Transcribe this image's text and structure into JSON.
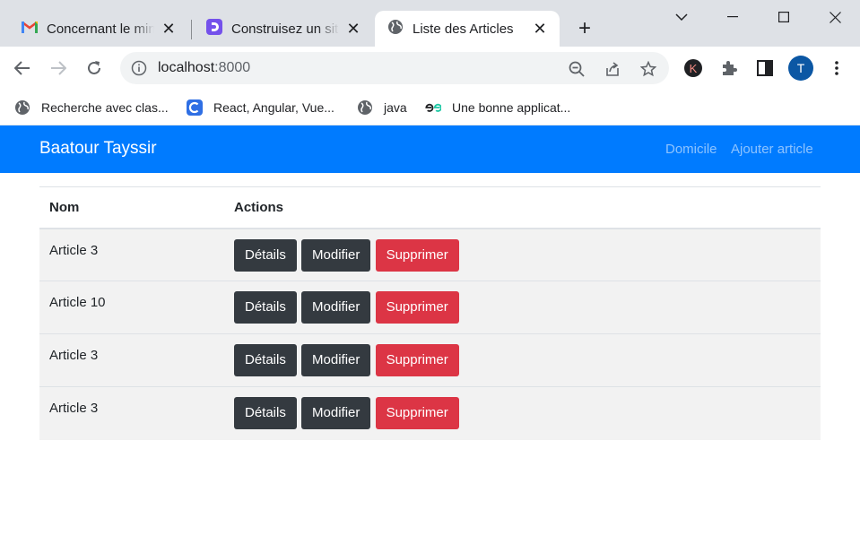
{
  "browser": {
    "tabs": [
      {
        "title": "Concernant le mini",
        "icon": "gmail-icon"
      },
      {
        "title": "Construisez un site",
        "icon": "openclassrooms-icon"
      },
      {
        "title": "Liste des Articles",
        "icon": "globe-icon",
        "active": true
      }
    ],
    "close_glyph": "✕",
    "newtab_glyph": "+",
    "url_host": "localhost",
    "url_port": ":8000",
    "profile_initial": "T",
    "extension_initial": "K",
    "bookmarks": [
      {
        "label": "Recherche avec clas...",
        "icon": "globe-icon"
      },
      {
        "label": "React, Angular, Vue...",
        "icon": "c-logo-icon"
      },
      {
        "label": "java",
        "icon": "globe-icon"
      },
      {
        "label": "Une bonne applicat...",
        "icon": "e-logo-icon"
      }
    ]
  },
  "navbar": {
    "brand": "Baatour Tayssir",
    "links": [
      "Domicile",
      "Ajouter article"
    ],
    "color": "#007bff"
  },
  "table": {
    "headers": [
      "Nom",
      "Actions"
    ],
    "rows": [
      {
        "name": "Article 3"
      },
      {
        "name": "Article 10"
      },
      {
        "name": "Article 3"
      },
      {
        "name": "Article 3"
      }
    ],
    "buttons": {
      "details": "Détails",
      "edit": "Modifier",
      "delete": "Supprimer"
    }
  },
  "colors": {
    "dark_button": "#343a40",
    "danger_button": "#dc3545"
  }
}
